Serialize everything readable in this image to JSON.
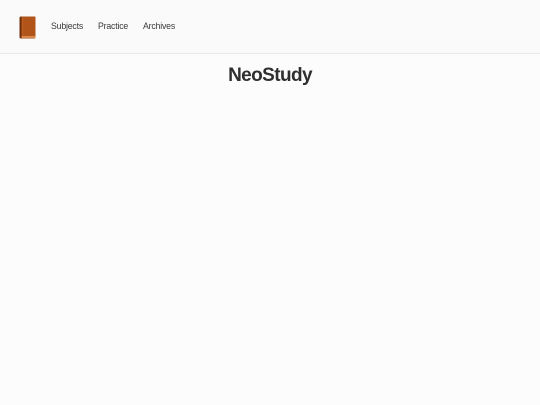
{
  "header": {
    "logo_icon": "book-icon",
    "nav": [
      {
        "label": "Subjects"
      },
      {
        "label": "Practice"
      },
      {
        "label": "Archives"
      }
    ]
  },
  "main": {
    "title": "NeoStudy"
  },
  "colors": {
    "logo_fill": "#b0541a",
    "logo_dark": "#6e2f0a",
    "background": "#fcfcfc"
  }
}
